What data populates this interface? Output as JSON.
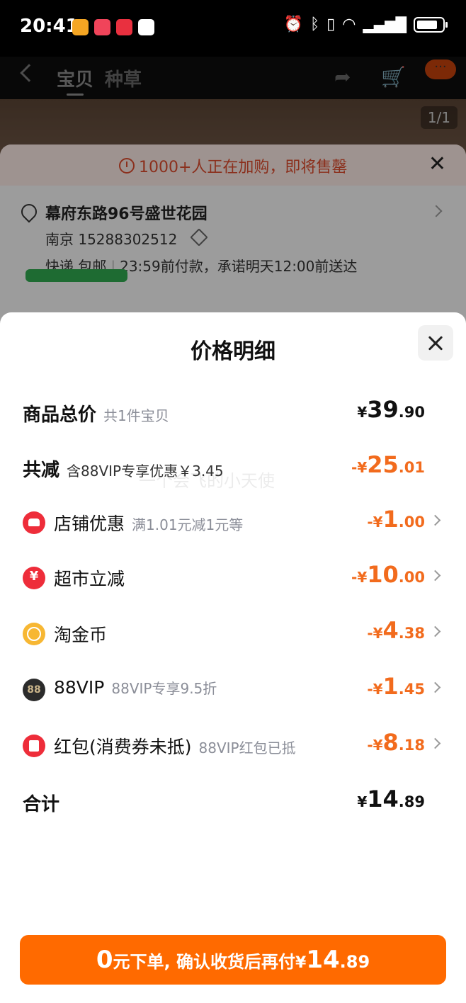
{
  "status_bar": {
    "time": "20:41",
    "battery_level": 0.85
  },
  "underlay": {
    "tabs": [
      "宝贝",
      "种草"
    ],
    "image_counter": "1/1",
    "alert_text": "1000+人正在加购，即将售罄",
    "address": "幕府东路96号盛世花园",
    "recipient": "南京  15288302512",
    "shipping_method": "快递 包邮",
    "shipping_promise": "23:59前付款，承诺明天12:00前送达"
  },
  "sheet": {
    "title": "价格明细",
    "watermark": "一个会飞的小天使",
    "rows": [
      {
        "label": "商品总价",
        "note": "共1件宝贝",
        "currency": "¥",
        "int": "39",
        "dec": ".90"
      },
      {
        "label": "共减",
        "note": "含88VIP专享优惠￥3.45",
        "currency": "-¥",
        "int": "25",
        "dec": ".01"
      },
      {
        "label": "店铺优惠",
        "note": "满1.01元减1元等",
        "currency": "-¥",
        "int": "1",
        "dec": ".00",
        "icon": "shop-coupon-icon"
      },
      {
        "label": "超市立减",
        "note": "",
        "currency": "-¥",
        "int": "10",
        "dec": ".00",
        "icon": "supermarket-discount-icon"
      },
      {
        "label": "淘金币",
        "note": "",
        "currency": "-¥",
        "int": "4",
        "dec": ".38",
        "icon": "taojinbi-coin-icon"
      },
      {
        "label": "88VIP",
        "note": "88VIP专享9.5折",
        "currency": "-¥",
        "int": "1",
        "dec": ".45",
        "icon": "vip88-icon",
        "icon_text": "88"
      },
      {
        "label": "红包(消费券未抵)",
        "note": "88VIP红包已抵",
        "currency": "-¥",
        "int": "8",
        "dec": ".18",
        "icon": "red-envelope-icon"
      },
      {
        "label": "合计",
        "note": "",
        "currency": "¥",
        "int": "14",
        "dec": ".89"
      }
    ],
    "cta": {
      "zero": "0",
      "mid": "元下单, 确认收货后再付",
      "currency": "¥",
      "int": "14",
      "dec": ".89"
    }
  },
  "colors": {
    "accent_orange": "#ff6a00",
    "discount_orange": "#f26b1d",
    "icon_red": "#ee2d3a"
  }
}
